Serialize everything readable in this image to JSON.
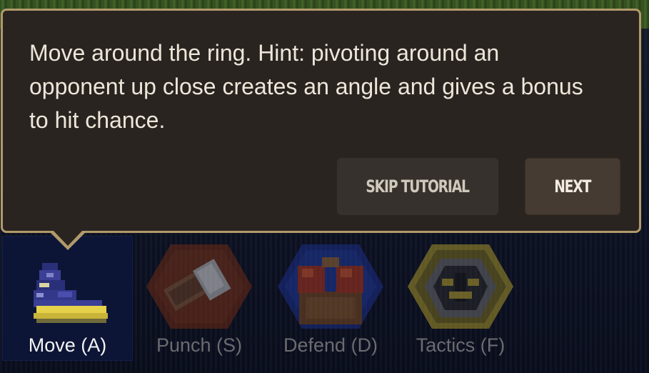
{
  "tutorial": {
    "message": "Move around the ring. Hint: pivoting around an opponent up close creates an angle and gives a bonus to hit chance.",
    "skip_label": "SKIP TUTORIAL",
    "next_label": "NEXT"
  },
  "actions": [
    {
      "label": "Move (A)",
      "icon": "boot-icon",
      "state": "selected"
    },
    {
      "label": "Punch (S)",
      "icon": "fist-icon",
      "state": "disabled"
    },
    {
      "label": "Defend (D)",
      "icon": "gloves-guard-icon",
      "state": "disabled"
    },
    {
      "label": "Tactics (F)",
      "icon": "helmet-icon",
      "state": "disabled"
    }
  ],
  "colors": {
    "popup_bg": "#2a2420",
    "popup_border": "#b19a6a",
    "selected_bg": "#0d1536",
    "label_active": "#f4f4f4",
    "label_disabled": "#6b6b70"
  }
}
